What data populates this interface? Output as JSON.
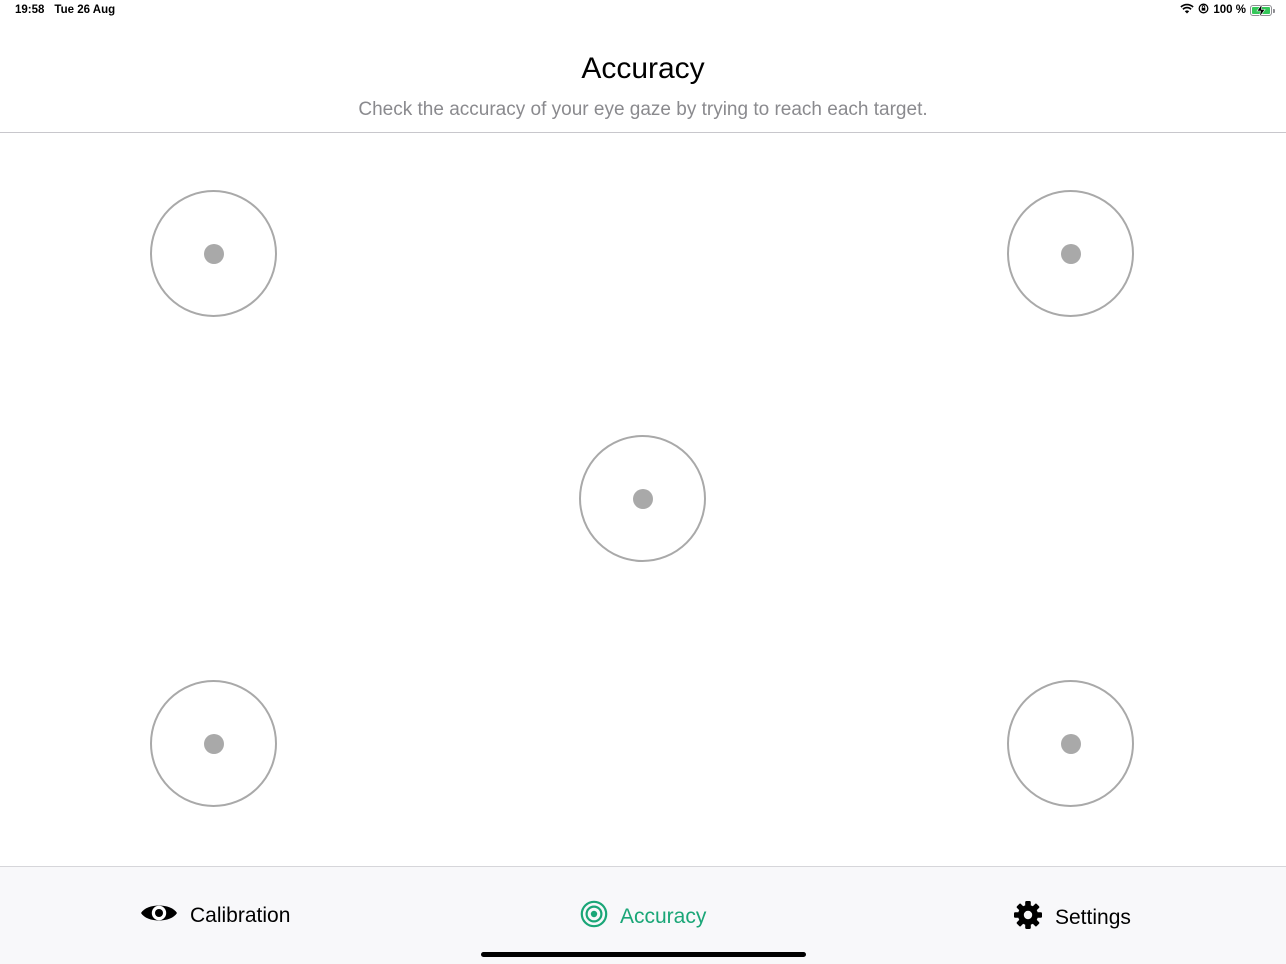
{
  "status_bar": {
    "time": "19:58",
    "date": "Tue 26 Aug",
    "battery": "100 %",
    "icons": [
      "wifi-icon",
      "orientation-lock-icon",
      "battery-charging-icon"
    ],
    "battery_color": "#34c759"
  },
  "header": {
    "title": "Accuracy",
    "subtitle": "Check the accuracy of your eye gaze by trying to reach each target."
  },
  "targets": [
    {
      "id": "top-left"
    },
    {
      "id": "top-right"
    },
    {
      "id": "center"
    },
    {
      "id": "bottom-left"
    },
    {
      "id": "bottom-right"
    }
  ],
  "tab_bar": {
    "tabs": [
      {
        "label": "Calibration",
        "icon": "eye-icon",
        "active": false
      },
      {
        "label": "Accuracy",
        "icon": "target-icon",
        "active": true
      },
      {
        "label": "Settings",
        "icon": "gear-icon",
        "active": false
      }
    ],
    "active_color": "#1aa677",
    "inactive_color": "#000000"
  }
}
